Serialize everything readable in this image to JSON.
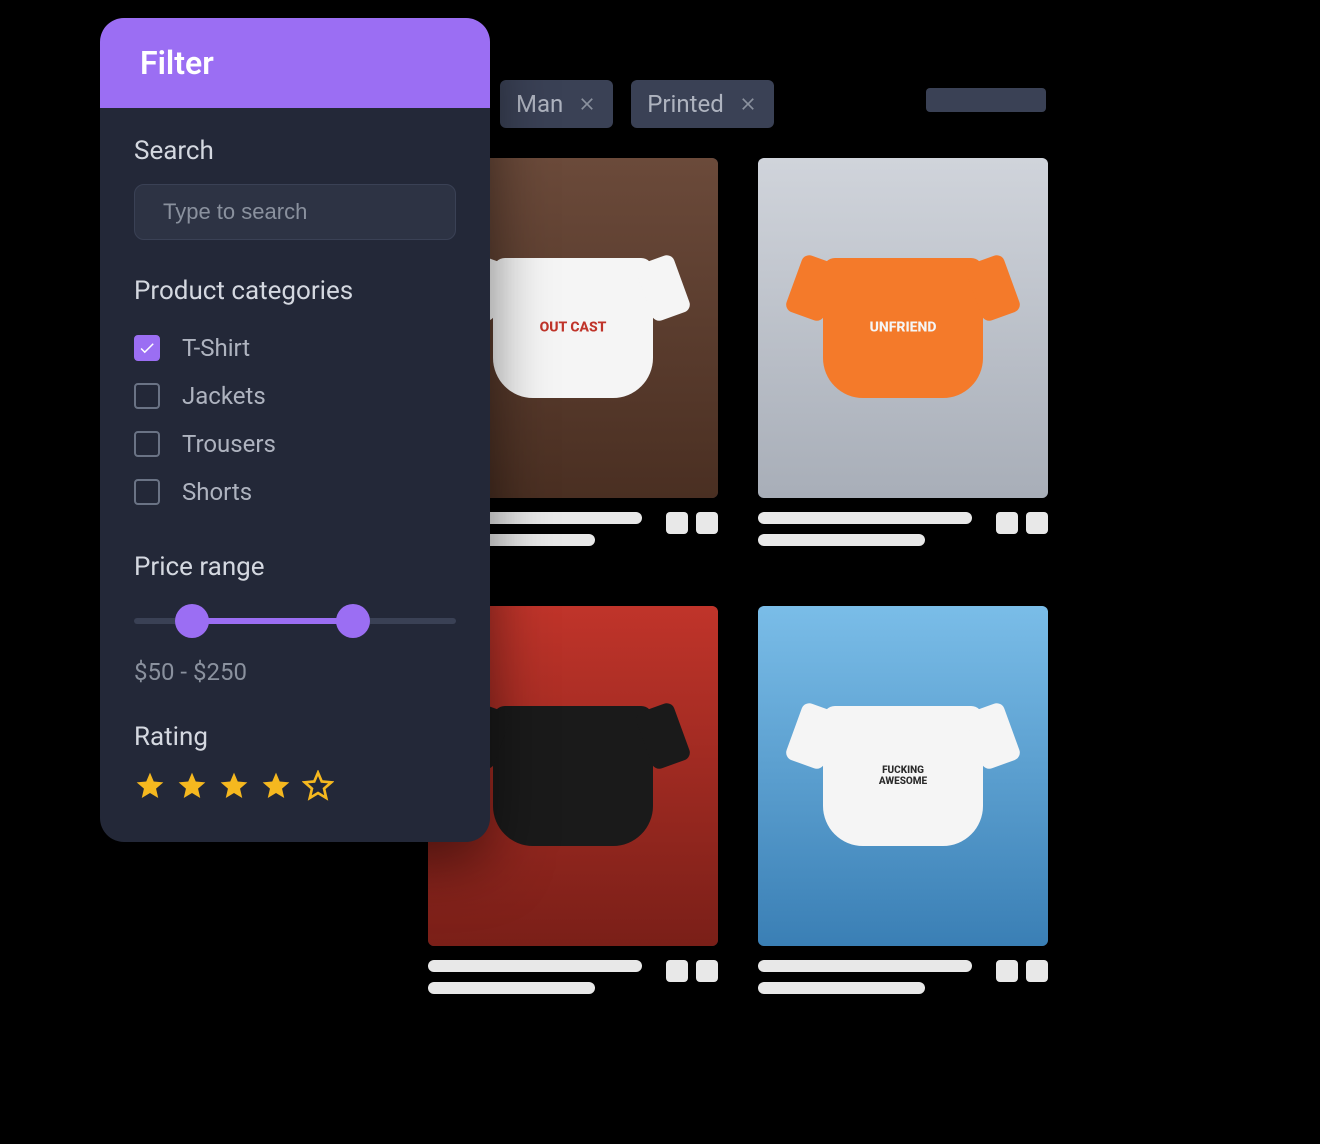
{
  "filter": {
    "title": "Filter",
    "search_label": "Search",
    "search_placeholder": "Type to search",
    "categories_label": "Product categories",
    "categories": [
      {
        "label": "T-Shirt",
        "checked": true
      },
      {
        "label": "Jackets",
        "checked": false
      },
      {
        "label": "Trousers",
        "checked": false
      },
      {
        "label": "Shorts",
        "checked": false
      }
    ],
    "price_label": "Price range",
    "price_text": "$50 - $250",
    "rating_label": "Rating",
    "rating_value": 4
  },
  "chips": [
    {
      "label": "Man"
    },
    {
      "label": "Printed"
    }
  ],
  "products": [
    {
      "shirt_text": "OUT CAST"
    },
    {
      "shirt_text": "UNFRIEND"
    },
    {
      "shirt_text": ""
    },
    {
      "shirt_text": "FUCKING AWESOME"
    }
  ],
  "colors": {
    "accent": "#9b6ef3",
    "star": "#f5b81f"
  }
}
